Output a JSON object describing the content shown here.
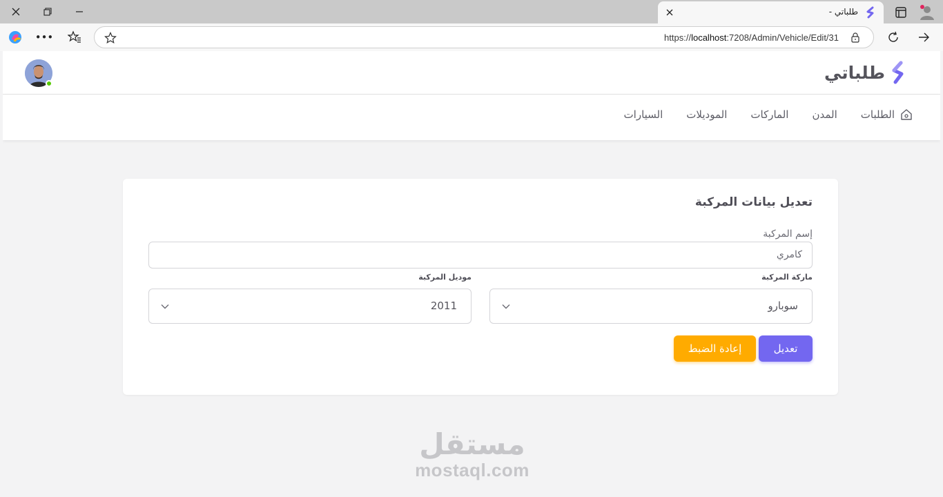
{
  "browser": {
    "tab_title": "طلباتي -",
    "url_prefix": "https://",
    "url_host": "localhost",
    "url_rest": ":7208/Admin/Vehicle/Edit/31",
    "icons": [
      "close-icon",
      "restore-icon",
      "minimize-icon",
      "new-tab-icon",
      "tab-actions-icon",
      "profile-icon",
      "copilot-icon",
      "more-icon",
      "favorites-icon",
      "star-icon",
      "lock-icon",
      "refresh-icon",
      "forward-icon"
    ]
  },
  "header": {
    "brand_name": "طلباتي",
    "brand_color": "#7367f0"
  },
  "nav": {
    "items": [
      {
        "label": "الطلبات",
        "icon": "home-icon"
      },
      {
        "label": "المدن"
      },
      {
        "label": "الماركات"
      },
      {
        "label": "الموديلات"
      },
      {
        "label": "السيارات"
      }
    ]
  },
  "form": {
    "title": "تعديل بيانات المركبة",
    "name_label": "إسم المركبة",
    "name_value": "كامري",
    "make_label": "ماركة المركبة",
    "make_value": "سوبارو",
    "model_label": "موديل المركبة",
    "model_value": "2011",
    "edit_button": "تعديل",
    "reset_button": "إعادة الضبط",
    "primary_color": "#7367f0",
    "warning_color": "#ffab00"
  },
  "watermark": {
    "arabic": "مستقل",
    "latin": "mostaql.com"
  }
}
